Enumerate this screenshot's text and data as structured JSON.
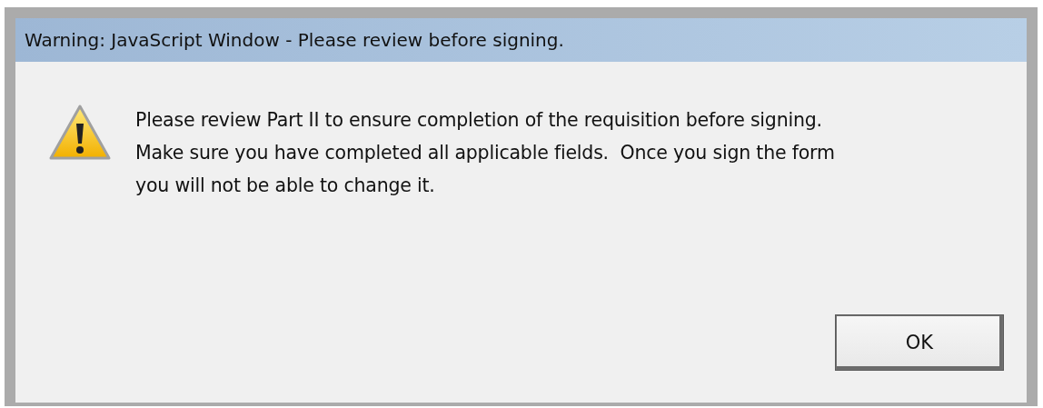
{
  "window": {
    "title": "Warning: JavaScript Window - Please review before signing."
  },
  "message": {
    "kind": "warning",
    "lines": [
      "Please review Part II to ensure completion of the requisition before signing.",
      "Make sure you have completed all applicable fields.  Once you sign the form",
      "you will not be able to change it."
    ]
  },
  "buttons": [
    {
      "label": "OK",
      "selected": true
    }
  ]
}
